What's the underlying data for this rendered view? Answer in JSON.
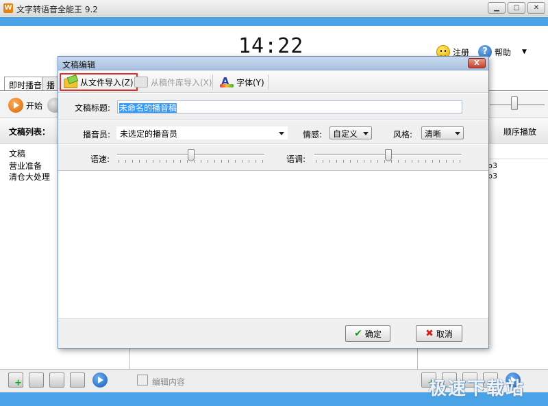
{
  "app": {
    "icon_glyph": "W",
    "title": "文字转语音全能王 9.2",
    "clock": "14:22",
    "register_label": "注册",
    "help_label": "帮助"
  },
  "tabs": [
    "即时播音",
    "播音"
  ],
  "toolbar": {
    "start_label": "开始"
  },
  "list": {
    "header_label": "文稿列表：",
    "order_label": "顺序播放",
    "column_header": "文稿",
    "items": [
      "营业准备",
      "清仓大处理"
    ],
    "right_items": [
      "p3",
      "p3"
    ]
  },
  "bottom": {
    "edit_label": "编辑内容",
    "watermark": "极速下载站"
  },
  "dialog": {
    "title": "文稿编辑",
    "close_glyph": "X",
    "toolbar": {
      "import_file": "从文件导入(Z)",
      "import_library": "从稿件库导入(X)",
      "font": "字体(Y)"
    },
    "form": {
      "title_label": "文稿标题:",
      "title_value": "未命名的播音稿",
      "announcer_label": "播音员:",
      "announcer_value": "未选定的播音员",
      "emotion_label": "情感:",
      "emotion_value": "自定义",
      "style_label": "风格:",
      "style_value": "清晰",
      "speed_label": "语速:",
      "pitch_label": "语调:",
      "speed_level": 0.5,
      "pitch_level": 0.5
    },
    "ok_label": "确定",
    "ok_glyph": "✔",
    "cancel_label": "取消",
    "cancel_glyph": "✖"
  },
  "colors": {
    "accent_blue": "#4aa3e6",
    "highlight_red": "#d9302b",
    "selection": "#3399ff"
  }
}
